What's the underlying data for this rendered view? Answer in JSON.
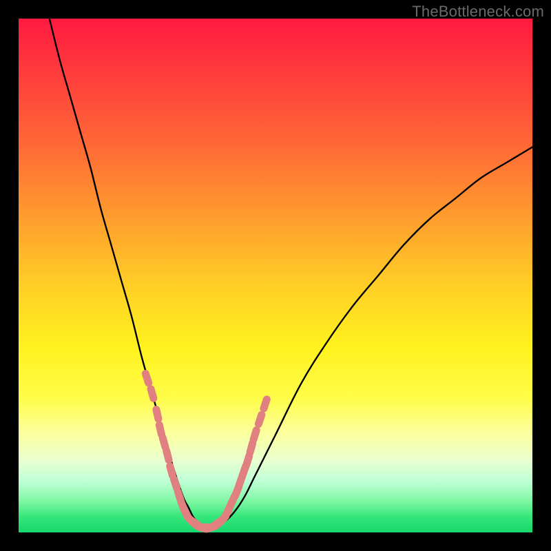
{
  "attribution": "TheBottleneck.com",
  "colors": {
    "frame": "#000000",
    "curve": "#000000",
    "marker": "#e08080",
    "gradient_top": "#ff1a40",
    "gradient_bottom": "#16d86c"
  },
  "chart_data": {
    "type": "line",
    "title": "",
    "xlabel": "",
    "ylabel": "",
    "xlim": [
      0,
      100
    ],
    "ylim": [
      0,
      100
    ],
    "series": [
      {
        "name": "bottleneck-curve",
        "x": [
          6,
          8,
          10,
          12,
          14,
          16,
          18,
          20,
          22,
          24,
          26,
          28,
          30,
          32,
          33,
          34,
          35,
          36,
          37,
          38,
          40,
          42,
          44,
          46,
          50,
          55,
          60,
          65,
          70,
          75,
          80,
          85,
          90,
          95,
          100
        ],
        "y": [
          100,
          92,
          85,
          78,
          71,
          63,
          56,
          49,
          42,
          34,
          27,
          20,
          13,
          7,
          5,
          3,
          2,
          1,
          1,
          1,
          2,
          4,
          7,
          11,
          19,
          29,
          37,
          44,
          50,
          56,
          61,
          65,
          69,
          72,
          75
        ]
      }
    ],
    "markers": {
      "name": "highlighted-segments",
      "x": [
        25,
        26,
        27,
        27.6,
        28.3,
        29,
        29.7,
        30.5,
        31.3,
        32,
        32.7,
        33.4,
        34.1,
        34.8,
        35.5,
        36.2,
        36.9,
        37.6,
        38.3,
        39,
        39.7,
        40.4,
        41.1,
        41.8,
        42.5,
        43.2,
        43.9,
        44.6,
        45.3,
        46,
        47,
        48
      ],
      "y": [
        30,
        27,
        23,
        20,
        17.5,
        15,
        12,
        9.5,
        7,
        5,
        3.5,
        2.5,
        2,
        1.5,
        1,
        1,
        1,
        1,
        1.5,
        2,
        2.5,
        3.5,
        5,
        6.5,
        8,
        10,
        12,
        14,
        16.5,
        19,
        22,
        25
      ]
    }
  }
}
